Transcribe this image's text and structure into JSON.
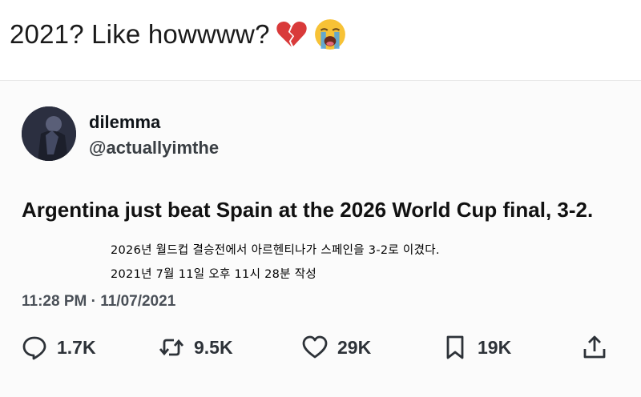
{
  "caption": {
    "text": "2021? Like howwww?",
    "emojis": [
      "broken-heart",
      "loudly-crying-face"
    ]
  },
  "tweet": {
    "display_name": "dilemma",
    "handle": "@actuallyimthe",
    "text": "Argentina just beat Spain at the 2026 World Cup final, 3-2.",
    "timestamp": "11:28 PM · 11/07/2021",
    "actions": {
      "reply_count": "1.7K",
      "retweet_count": "9.5K",
      "like_count": "29K",
      "bookmark_count": "19K"
    }
  },
  "overlay": {
    "line1": "2026년 월드컵 결승전에서 아르헨티나가 스페인을 3-2로 이겼다.",
    "line2": "2021년 7월 11일 오후 11시 28분 작성"
  },
  "colors": {
    "heart_red": "#d93a3a",
    "emoji_yellow": "#f7c236",
    "tear_blue": "#4aa3e6",
    "text_dark": "#0f1419",
    "text_muted": "#4a5058"
  }
}
